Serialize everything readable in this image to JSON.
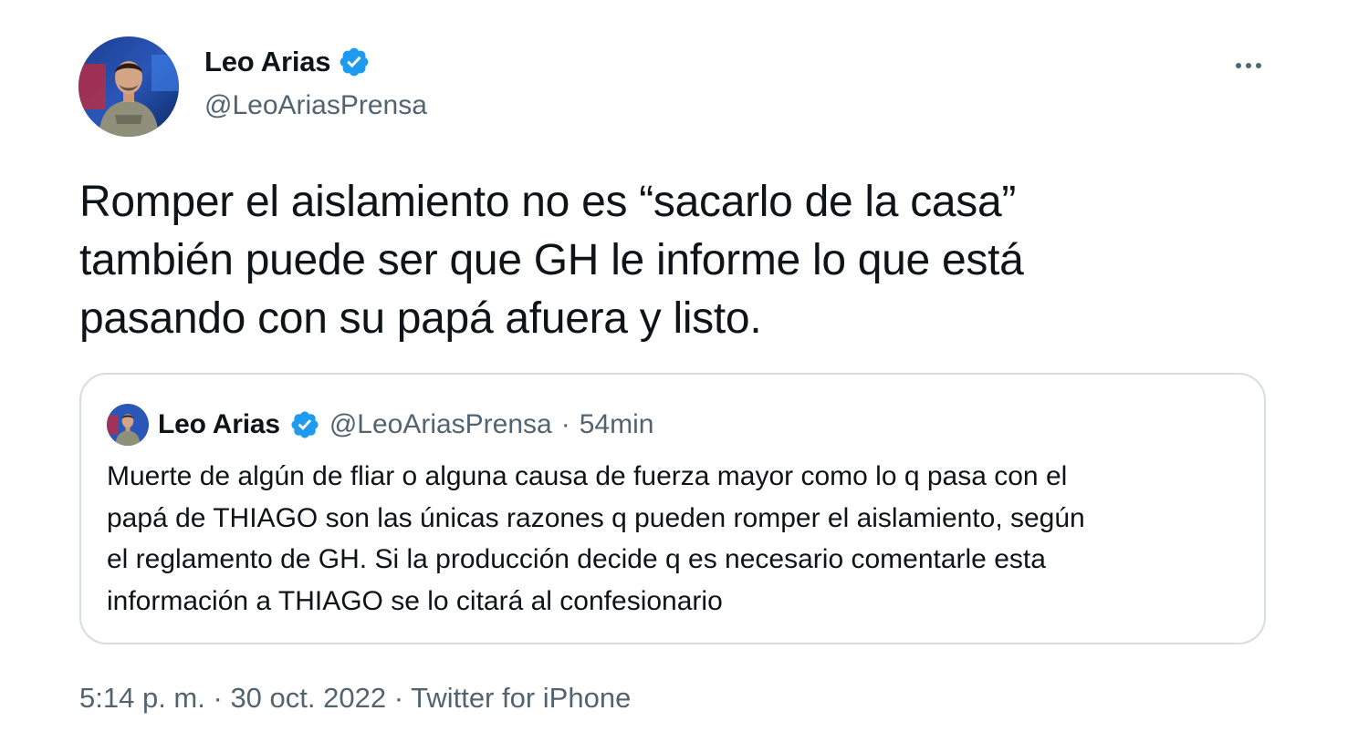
{
  "author": {
    "name": "Leo Arias",
    "handle": "@LeoAriasPrensa",
    "avatar_icon": "profile-photo",
    "verified_icon": "verified-badge-icon"
  },
  "colors": {
    "verified": "#1d9bf0",
    "text": "#0f1419",
    "secondary": "#536471",
    "border": "#d7dde1"
  },
  "tweet": {
    "text_lines": [
      "Romper el aislamiento no es “sacarlo de la casa”",
      "también puede ser que GH le informe lo que está",
      "pasando con su papá afuera y listo."
    ]
  },
  "quoted": {
    "name": "Leo Arias",
    "handle": "@LeoAriasPrensa",
    "separator": "·",
    "time": "54min",
    "text_lines": [
      "Muerte de algún de fliar o alguna causa de fuerza mayor como lo q pasa con el",
      "papá de THIAGO son las únicas razones q pueden romper el aislamiento, según",
      "el reglamento de GH. Si la producción decide q es necesario comentarle esta",
      "información a THIAGO se lo citará al confesionario"
    ]
  },
  "meta": {
    "time": "5:14 p. m.",
    "separator": "·",
    "date": "30 oct. 2022",
    "source": "Twitter for iPhone"
  },
  "more_icon": "more-horizontal-icon"
}
